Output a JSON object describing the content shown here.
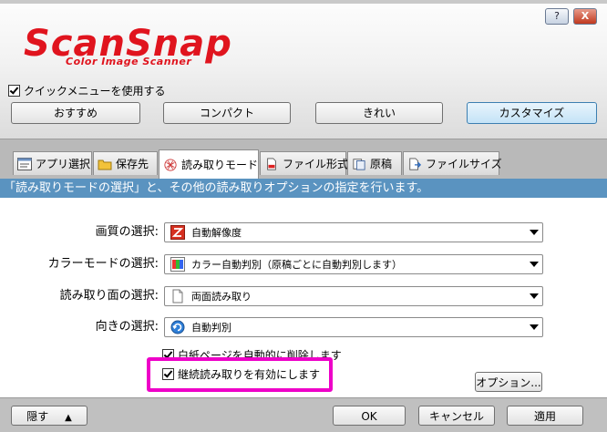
{
  "window": {
    "help_label": "?",
    "close_label": "X"
  },
  "logo": {
    "main": "ScanSnap",
    "sub": "Color Image Scanner"
  },
  "quick_menu": {
    "label": "クイックメニューを使用する",
    "checked": true
  },
  "presets": [
    {
      "label": "おすすめ",
      "active": false
    },
    {
      "label": "コンパクト",
      "active": false
    },
    {
      "label": "きれい",
      "active": false
    },
    {
      "label": "カスタマイズ",
      "active": true
    }
  ],
  "tabs": [
    {
      "label": "アプリ選択",
      "icon": "app-select-icon"
    },
    {
      "label": "保存先",
      "icon": "folder-icon"
    },
    {
      "label": "読み取りモード",
      "icon": "scan-mode-icon",
      "active": true
    },
    {
      "label": "ファイル形式",
      "icon": "file-format-icon"
    },
    {
      "label": "原稿",
      "icon": "paper-icon"
    },
    {
      "label": "ファイルサイズ",
      "icon": "file-size-icon"
    }
  ],
  "info_text": "「読み取りモードの選択」と、その他の読み取りオプションの指定を行います。",
  "settings": [
    {
      "label": "画質の選択:",
      "value": "自動解像度",
      "icon": "auto-resolution-icon"
    },
    {
      "label": "カラーモードの選択:",
      "value": "カラー自動判別（原稿ごとに自動判別します）",
      "icon": "color-mode-icon"
    },
    {
      "label": "読み取り面の選択:",
      "value": "両面読み取り",
      "icon": "duplex-icon"
    },
    {
      "label": "向きの選択:",
      "value": "自動判別",
      "icon": "rotation-icon"
    }
  ],
  "options": {
    "blank_page": {
      "label": "白紙ページを自動的に削除します",
      "checked": true
    },
    "continuous": {
      "label": "継続読み取りを有効にします",
      "checked": true
    },
    "options_button": "オプション..."
  },
  "footer": {
    "hide": "隠す",
    "ok": "OK",
    "cancel": "キャンセル",
    "apply": "適用"
  },
  "colors": {
    "logo_red": "#e0141e",
    "info_bar": "#5a93c0",
    "highlight": "#ee00c8"
  }
}
